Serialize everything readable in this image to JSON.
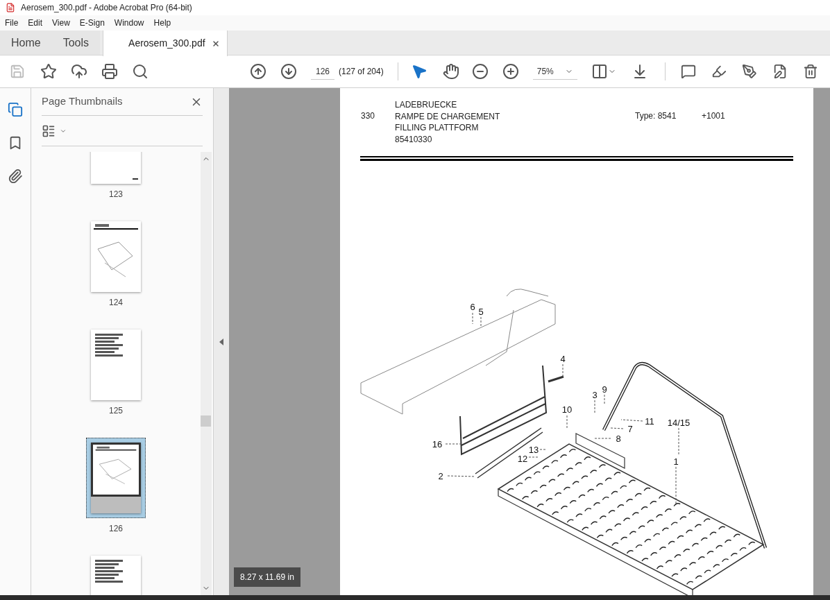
{
  "window": {
    "title": "Aerosem_300.pdf - Adobe Acrobat Pro (64-bit)"
  },
  "menu": [
    "File",
    "Edit",
    "View",
    "E-Sign",
    "Window",
    "Help"
  ],
  "tabs": [
    {
      "label": "Home",
      "selected": false,
      "kind": "nav"
    },
    {
      "label": "Tools",
      "selected": false,
      "kind": "nav"
    },
    {
      "label": "Aerosem_300.pdf",
      "selected": true,
      "kind": "document"
    }
  ],
  "toolbar": {
    "save_disabled": true,
    "page_number": "126",
    "page_count": "(127 of 204)",
    "zoom": "75%",
    "tools": [
      {
        "kind": "select",
        "selected": true
      },
      {
        "kind": "hand",
        "selected": false
      }
    ]
  },
  "sidebar": {
    "title": "Page Thumbnails",
    "thumbnails": [
      {
        "label": "123",
        "selected": false,
        "kind": "blank"
      },
      {
        "label": "124",
        "selected": false,
        "kind": "diagram"
      },
      {
        "label": "125",
        "selected": false,
        "kind": "list"
      },
      {
        "label": "126",
        "selected": true,
        "kind": "diagram"
      },
      {
        "selected": false,
        "kind": "list"
      }
    ]
  },
  "document": {
    "header": {
      "section": "330",
      "titles": [
        "LADEBRUECKE",
        "RAMPE DE CHARGEMENT",
        "FILLING PLATTFORM",
        "85410330"
      ],
      "type": "Type: 8541",
      "variant": "+1001"
    },
    "callouts": [
      "6",
      "5",
      "4",
      "10",
      "3",
      "9",
      "11",
      "7",
      "8",
      "14/15",
      "16",
      "13",
      "12",
      "2",
      "1"
    ],
    "page_size": "8.27 x 11.69 in"
  }
}
